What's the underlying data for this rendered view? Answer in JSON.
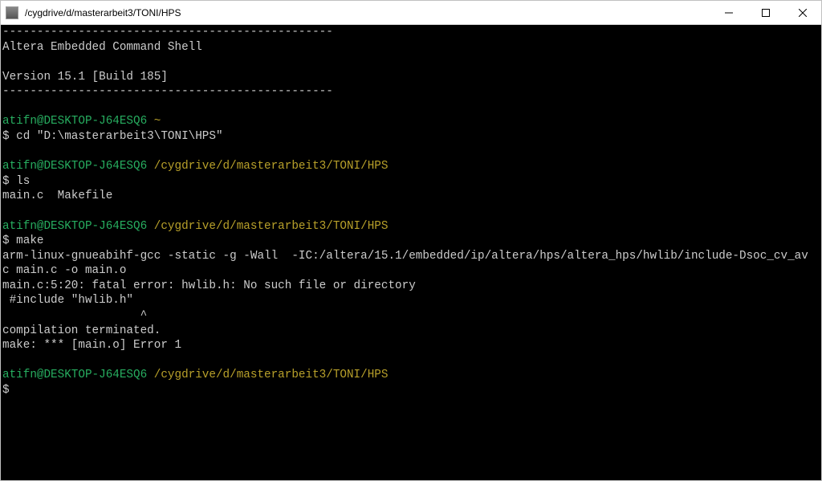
{
  "window": {
    "title": "/cygdrive/d/masterarbeit3/TONI/HPS"
  },
  "banner": {
    "dash": "------------------------------------------------",
    "line1": "Altera Embedded Command Shell",
    "blank": "",
    "line2": "Version 15.1 [Build 185]"
  },
  "prompts": [
    {
      "user": "atifn@DESKTOP-J64ESQ6",
      "path": " ~"
    },
    {
      "user": "atifn@DESKTOP-J64ESQ6",
      "path": " /cygdrive/d/masterarbeit3/TONI/HPS"
    },
    {
      "user": "atifn@DESKTOP-J64ESQ6",
      "path": " /cygdrive/d/masterarbeit3/TONI/HPS"
    },
    {
      "user": "atifn@DESKTOP-J64ESQ6",
      "path": " /cygdrive/d/masterarbeit3/TONI/HPS"
    }
  ],
  "cmds": {
    "cd": "$ cd \"D:\\masterarbeit3\\TONI\\HPS\"",
    "ls": "$ ls",
    "make": "$ make",
    "empty": "$"
  },
  "output": {
    "ls": "main.c  Makefile",
    "make1": "arm-linux-gnueabihf-gcc -static -g -Wall  -IC:/altera/15.1/embedded/ip/altera/hps/altera_hps/hwlib/include-Dsoc_cv_av  -",
    "make2": "c main.c -o main.o",
    "make3": "main.c:5:20: fatal error: hwlib.h: No such file or directory",
    "make4": " #include \"hwlib.h\"",
    "make5": "                    ^",
    "make6": "compilation terminated.",
    "make7": "make: *** [main.o] Error 1"
  }
}
